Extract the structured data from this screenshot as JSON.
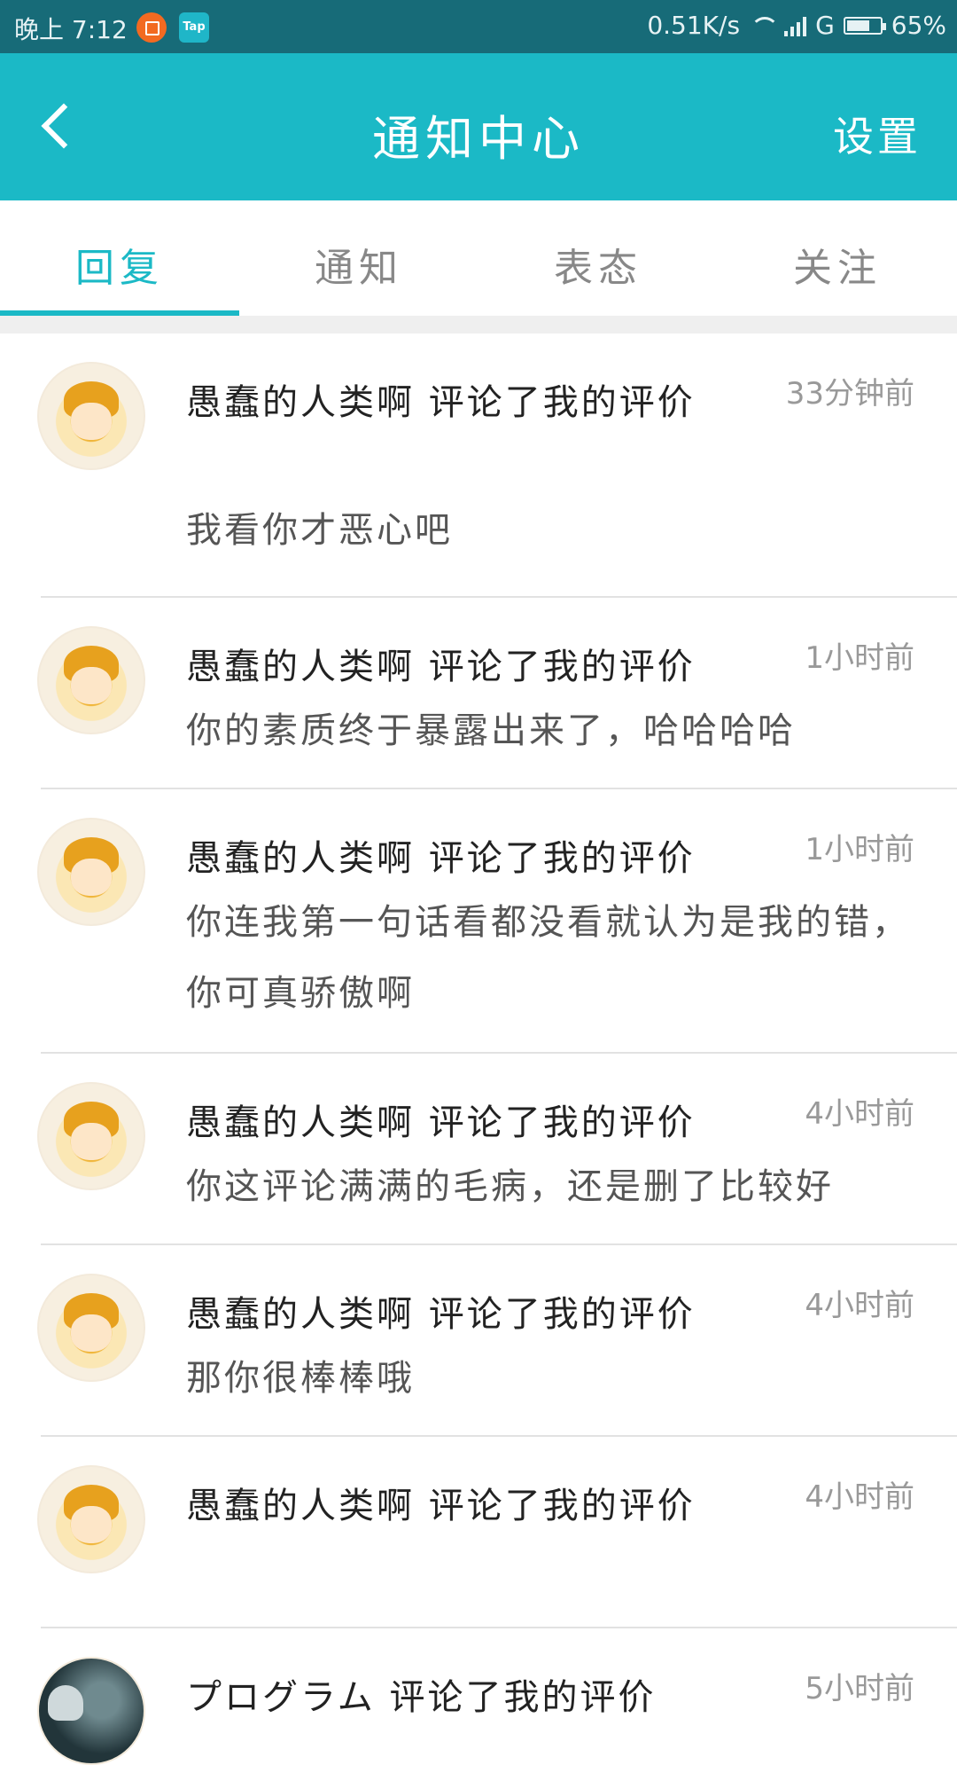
{
  "status_bar": {
    "time": "晚上 7:12",
    "app2_label": "Tap",
    "net_speed": "0.51K/s",
    "network": "G",
    "battery": "65%"
  },
  "header": {
    "title": "通知中心",
    "settings": "设置"
  },
  "tabs": [
    {
      "label": "回复",
      "active": true
    },
    {
      "label": "通知",
      "active": false
    },
    {
      "label": "表态",
      "active": false
    },
    {
      "label": "关注",
      "active": false
    }
  ],
  "notifications": [
    {
      "title": "愚蠢的人类啊 评论了我的评价",
      "time": "33分钟前",
      "text": "我看你才恶心吧"
    },
    {
      "title": "愚蠢的人类啊 评论了我的评价",
      "time": "1小时前",
      "text": "你的素质终于暴露出来了，哈哈哈哈"
    },
    {
      "title": "愚蠢的人类啊 评论了我的评价",
      "time": "1小时前",
      "text": "你连我第一句话看都没看就认为是我的错，你可真骄傲啊"
    },
    {
      "title": "愚蠢的人类啊 评论了我的评价",
      "time": "4小时前",
      "text": "你这评论满满的毛病，还是删了比较好"
    },
    {
      "title": "愚蠢的人类啊 评论了我的评价",
      "time": "4小时前",
      "text": "那你很棒棒哦"
    },
    {
      "title": "愚蠢的人类啊 评论了我的评价",
      "time": "4小时前",
      "text": ""
    },
    {
      "title": "プログラム 评论了我的评价",
      "time": "5小时前",
      "text": ""
    }
  ],
  "colors": {
    "accent": "#1bb9c6",
    "status_bar": "#176b78"
  }
}
